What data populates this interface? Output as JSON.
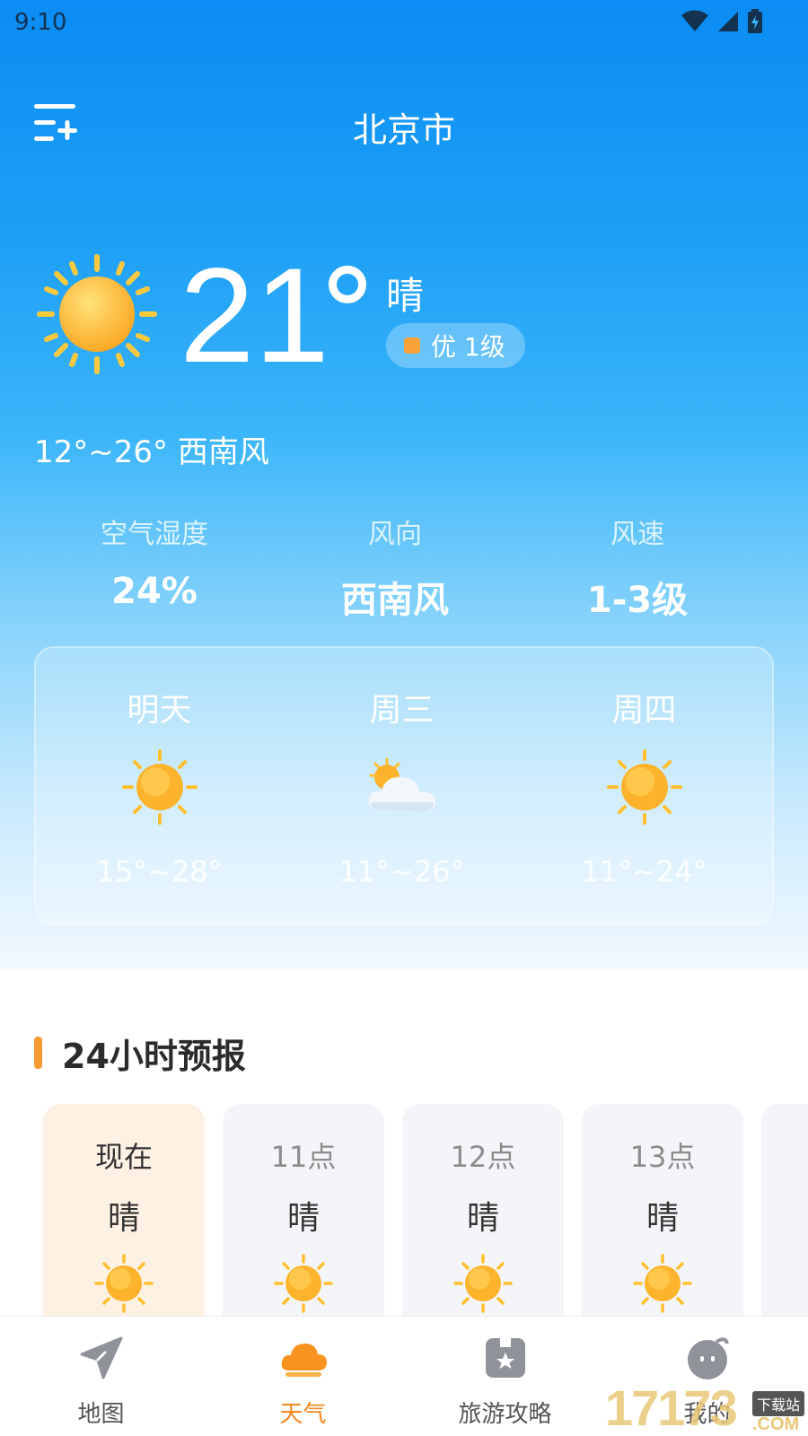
{
  "status_bar": {
    "time": "9:10"
  },
  "header": {
    "city": "北京市"
  },
  "current": {
    "temperature": "21",
    "condition": "晴",
    "aqi_label": "优 1级",
    "range_and_wind": "12°~26° 西南风"
  },
  "stats": [
    {
      "label": "空气湿度",
      "value": "24%"
    },
    {
      "label": "风向",
      "value": "西南风"
    },
    {
      "label": "风速",
      "value": "1-3级"
    }
  ],
  "forecast": [
    {
      "day": "明天",
      "icon": "sun-icon",
      "range": "15°~28°"
    },
    {
      "day": "周三",
      "icon": "partly-cloudy-icon",
      "range": "11°~26°"
    },
    {
      "day": "周四",
      "icon": "sun-icon",
      "range": "11°~24°"
    }
  ],
  "hourly": {
    "title": "24小时预报",
    "items": [
      {
        "time": "现在",
        "condition": "晴",
        "icon": "sun-icon"
      },
      {
        "time": "11点",
        "condition": "晴",
        "icon": "sun-icon"
      },
      {
        "time": "12点",
        "condition": "晴",
        "icon": "sun-icon"
      },
      {
        "time": "13点",
        "condition": "晴",
        "icon": "sun-icon"
      }
    ]
  },
  "tabbar": [
    {
      "label": "地图",
      "icon": "navigation-arrow-icon",
      "active": false
    },
    {
      "label": "天气",
      "icon": "cloud-icon",
      "active": true
    },
    {
      "label": "旅游攻略",
      "icon": "travel-guide-icon",
      "active": false
    },
    {
      "label": "我的",
      "icon": "profile-face-icon",
      "active": false
    }
  ],
  "watermark": {
    "main": "17173",
    "tag": "下载站",
    "suffix": ".COM"
  },
  "colors": {
    "accent": "#f5881f",
    "sky_top": "#0a8cf4",
    "aqi_dot": "#f9a23a"
  }
}
